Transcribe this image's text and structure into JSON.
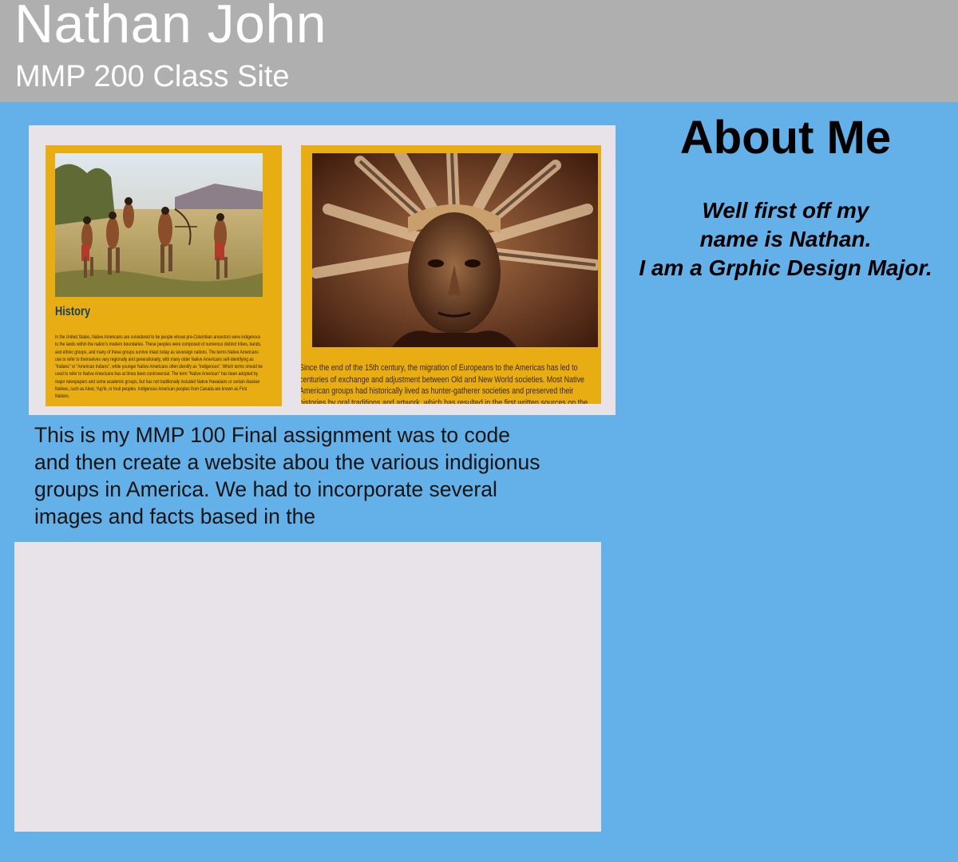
{
  "header": {
    "title": "Nathan John",
    "subtitle": "MMP 200 Class Site"
  },
  "project": {
    "history_card": {
      "heading": "History",
      "body": "In the United States, Native Americans are considered to be people whose pre-Columbian ancestors were indigenous to the lands within the nation's modern boundaries. These peoples were composed of numerous distinct tribes, bands, and ethnic groups, and many of these groups survive intact today as sovereign nations. The terms Native Americans use to refer to themselves vary regionally and generationally, with many older Native Americans self-identifying as \"Indians\" or \"American Indians\", while younger Native Americans often identify as \"Indigenous\". Which terms should be used to refer to Native Americans has at times been controversial. The term \"Native American\" has been adopted by major newspapers and some academic groups, but has not traditionally included Native Hawaiians or certain Alaskan Natives, such as Aleut, Yup'ik, or Inuit peoples. Indigenous American peoples from Canada are known as First Nations."
    },
    "chief_card": {
      "caption": "Since the end of the 15th century, the migration of Europeans to the Americas has led to centuries of exchange and adjustment between Old and New World societies. Most Native American groups had historically lived as hunter-gatherer societies and preserved their histories by oral traditions and artwork, which has resulted in the first written sources on the conflict being authored by Europeans."
    },
    "description": "This is my MMP 100 Final assignment was to code and then create a website abou the various indigionus groups in America. We had to incorporate several images and facts based in the"
  },
  "about": {
    "title": "About Me",
    "lines": [
      "Well first off my",
      "name is Nathan.",
      "I am a Grphic Design Major."
    ]
  },
  "colors": {
    "page_background": "#64b0e8",
    "header_background": "#afafaf",
    "panel_background": "#e8e3e8",
    "card_gold": "#e8ad12"
  }
}
